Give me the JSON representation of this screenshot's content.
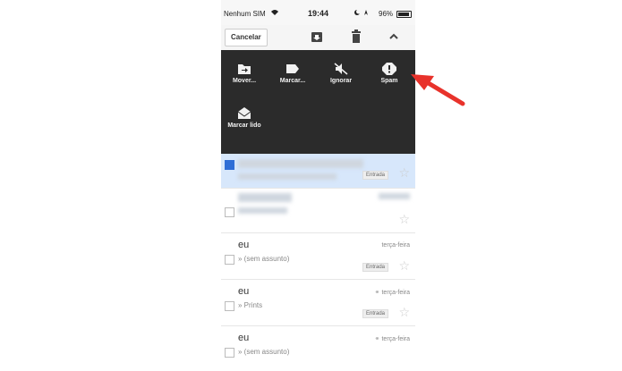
{
  "status_bar": {
    "carrier": "Nenhum SIM",
    "time": "19:44",
    "battery": "96%"
  },
  "toolbar": {
    "cancel_label": "Cancelar"
  },
  "menu": {
    "items": [
      {
        "label": "Mover...",
        "icon": "move-to-folder-icon"
      },
      {
        "label": "Marcar...",
        "icon": "label-tag-icon"
      },
      {
        "label": "Ignorar",
        "icon": "mute-icon"
      },
      {
        "label": "Spam",
        "icon": "spam-alert-icon"
      },
      {
        "label": "Marcar lido",
        "icon": "mark-read-envelope-icon"
      }
    ]
  },
  "emails": [
    {
      "sender": "",
      "subject": "",
      "date": "",
      "badge": "Entrada",
      "selected": true,
      "blurred": true
    },
    {
      "sender": "",
      "subject": "",
      "date": "",
      "badge": "",
      "selected": false,
      "blurred": true
    },
    {
      "sender": "eu",
      "subject": "(sem assunto)",
      "date": "terça-feira",
      "badge": "Entrada",
      "selected": false,
      "blurred": false
    },
    {
      "sender": "eu",
      "subject": "Prints",
      "date": "terça-feira",
      "badge": "Entrada",
      "selected": false,
      "blurred": false,
      "attachment": true
    },
    {
      "sender": "eu",
      "subject": "(sem assunto)",
      "date": "terça-feira",
      "badge": "",
      "selected": false,
      "blurred": false,
      "attachment": true
    }
  ],
  "colors": {
    "overlay": "#2b2b2b",
    "selected_row": "#d7e7fb",
    "arrow": "#e8322b"
  }
}
